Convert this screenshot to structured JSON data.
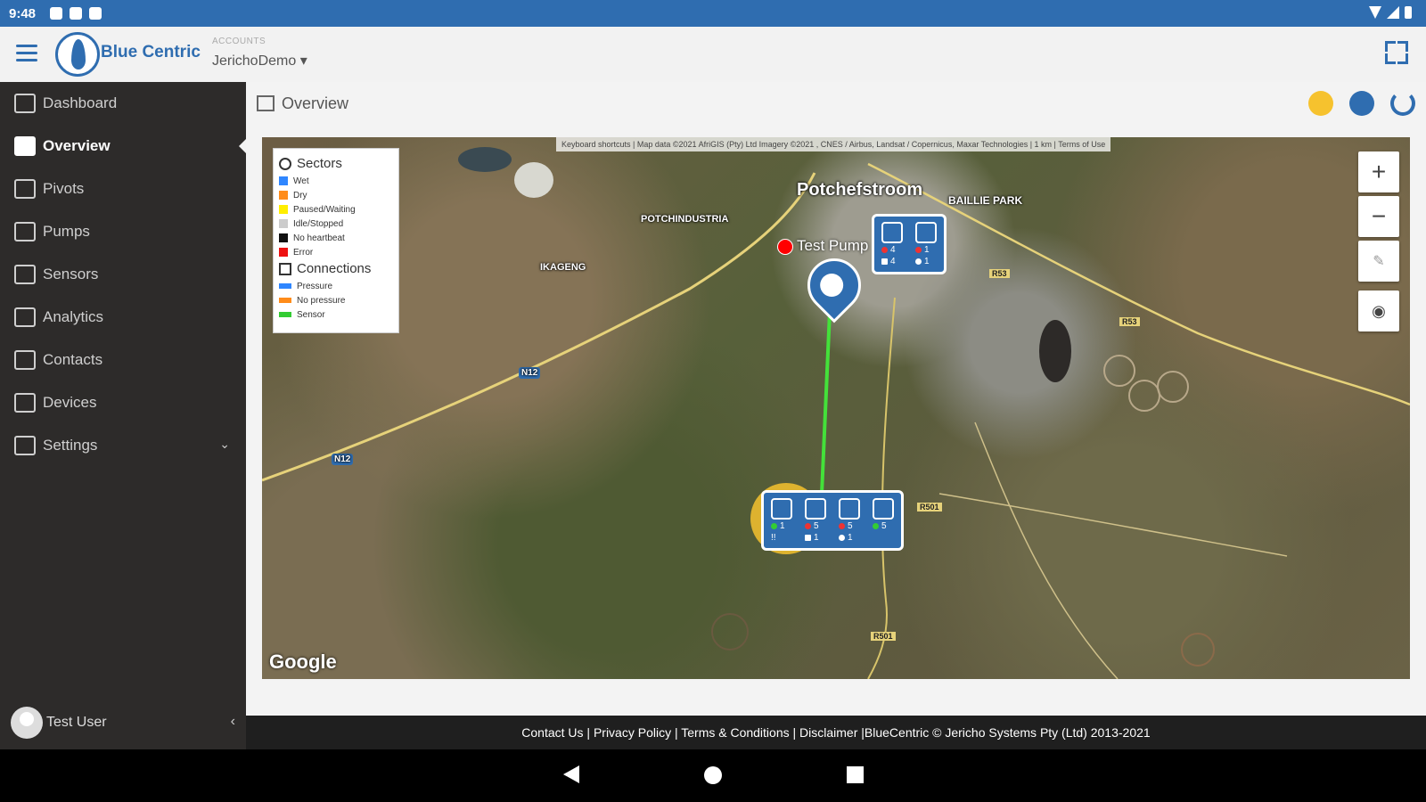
{
  "status_bar": {
    "time": "9:48"
  },
  "app": {
    "logo_text": "Blue Centric",
    "accounts_label": "ACCOUNTS",
    "account_name": "JerichoDemo ▾"
  },
  "sidebar": {
    "items": [
      {
        "label": "Dashboard",
        "icon": "dashboard-icon"
      },
      {
        "label": "Overview",
        "icon": "overview-icon"
      },
      {
        "label": "Pivots",
        "icon": "pivot-icon"
      },
      {
        "label": "Pumps",
        "icon": "pump-icon"
      },
      {
        "label": "Sensors",
        "icon": "sensor-icon"
      },
      {
        "label": "Analytics",
        "icon": "analytics-icon"
      },
      {
        "label": "Contacts",
        "icon": "contacts-icon"
      },
      {
        "label": "Devices",
        "icon": "device-icon"
      },
      {
        "label": "Settings",
        "icon": "gear-icon"
      }
    ],
    "active": "Overview",
    "settings_chevron": "⌄",
    "user_name": "Test User",
    "collapse_glyph": "‹"
  },
  "page": {
    "title": "Overview"
  },
  "map": {
    "attribution": "Keyboard shortcuts | Map data ©2021 AfriGIS (Pty) Ltd Imagery ©2021 , CNES / Airbus, Landsat / Copernicus, Maxar Technologies | 1 km | Terms of Use",
    "google_label": "Google",
    "zoom_in": "+",
    "zoom_out": "−",
    "legend": {
      "sectors_title": "Sectors",
      "sectors": [
        {
          "label": "Wet",
          "color": "#2f86ff"
        },
        {
          "label": "Dry",
          "color": "#ff8c1a"
        },
        {
          "label": "Paused/Waiting",
          "color": "#ffee00"
        },
        {
          "label": "Idle/Stopped",
          "color": "#cccccc"
        },
        {
          "label": "No heartbeat",
          "color": "#111111"
        },
        {
          "label": "Error",
          "color": "#ee1111"
        }
      ],
      "connections_title": "Connections",
      "connections": [
        {
          "label": "Pressure",
          "color": "#2f86ff"
        },
        {
          "label": "No pressure",
          "color": "#ff8c1a"
        },
        {
          "label": "Sensor",
          "color": "#33cc33"
        }
      ]
    },
    "places": {
      "potchefstroom": "Potchefstroom",
      "baillie_park": "BAILLIE PARK",
      "potchindustria": "POTCHINDUSTRIA",
      "ikageng": "IKAGENG",
      "route_n12a": "N12",
      "route_n12b": "N12",
      "r53": "R53",
      "r501": "R501",
      "r501b": "R501",
      "r53b": "R53"
    },
    "pump_label": "Test Pump",
    "cluster_top": {
      "stats": [
        "4",
        "1",
        "4",
        "1"
      ]
    },
    "cluster_bottom": {
      "stats_row1": [
        "1",
        "5",
        "5",
        "5"
      ],
      "stats_row2": [
        "!!",
        "1",
        "1"
      ]
    }
  },
  "footer": {
    "text": "Contact Us | Privacy Policy | Terms & Conditions | Disclaimer |BlueCentric © Jericho Systems Pty (Ltd) 2013-2021"
  }
}
